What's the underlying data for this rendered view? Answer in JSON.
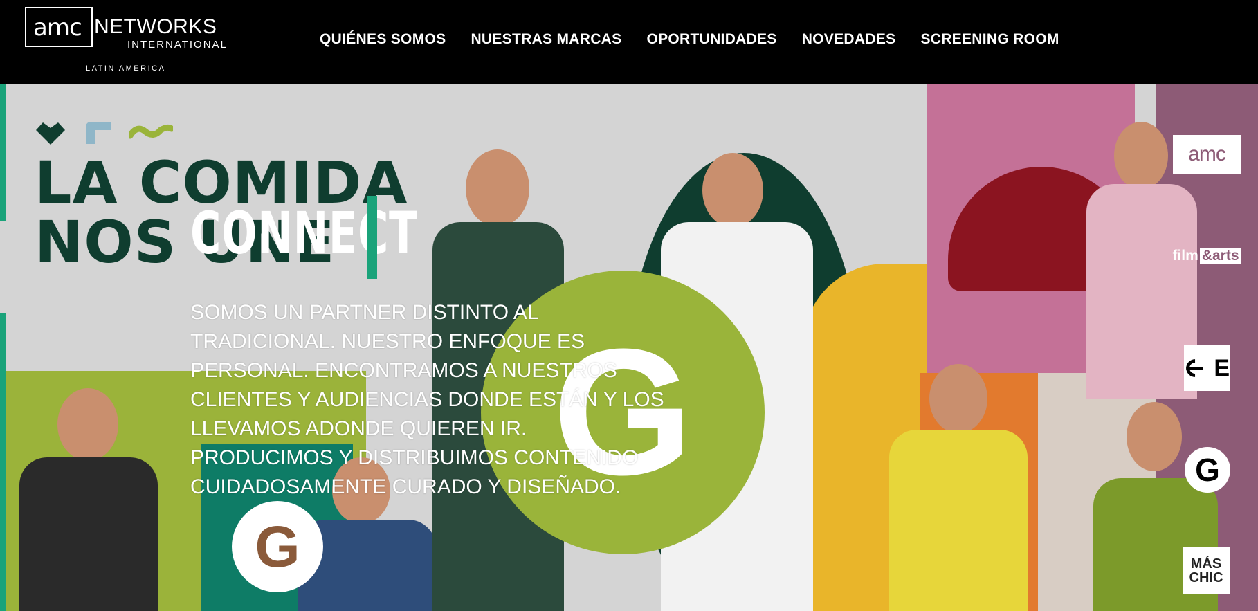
{
  "header": {
    "logo": {
      "amc": "amc",
      "networks": "NETWORKS",
      "international": "INTERNATIONAL",
      "region": "LATIN AMERICA"
    },
    "nav": [
      {
        "label": "QUIÉNES SOMOS"
      },
      {
        "label": "NUESTRAS MARCAS"
      },
      {
        "label": "OPORTUNIDADES"
      },
      {
        "label": "NOVEDADES"
      },
      {
        "label": "SCREENING ROOM"
      }
    ]
  },
  "hero": {
    "headline_line1": "LA COMIDA",
    "headline_line2": "NOS UNE",
    "big_g": "G",
    "overlay": {
      "title": "CONNECT",
      "body_lines": [
        "SOMOS UN PARTNER DISTINTO AL",
        "TRADICIONAL. NUESTRO ENFOQUE ES",
        "PERSONAL. ENCONTRAMOS A NUESTROS",
        "CLIENTES Y AUDIENCIAS DONDE ESTÁN Y LOS",
        "LLEVAMOS ADONDE QUIEREN IR.",
        "PRODUCIMOS Y DISTRIBUIMOS CONTENIDO",
        "CUIDADOSAMENTE CURADO Y DISEÑADO."
      ]
    },
    "channel_badge": "G"
  },
  "brands": {
    "amc": "amc",
    "film_arts_left": "film",
    "film_arts_amp": "&arts",
    "el_gourmet_e": "E",
    "gourmet_g": "G",
    "mas_chic_line1": "MÁS",
    "mas_chic_line2": "CHIC"
  },
  "colors": {
    "dark_green": "#0f3d2f",
    "accent_green": "#1aa37a",
    "olive": "#9ab43a",
    "mauve": "#8d5b76",
    "pink": "#c47197"
  }
}
